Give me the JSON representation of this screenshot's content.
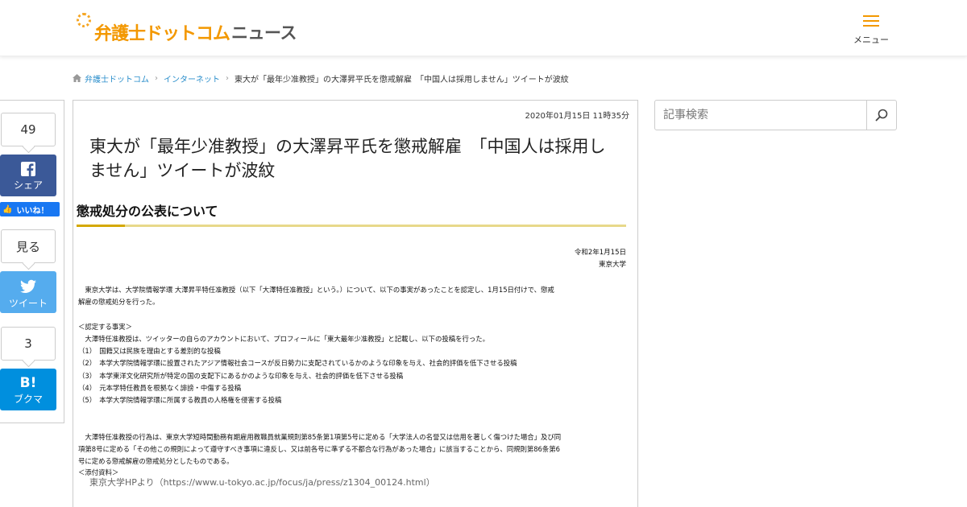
{
  "header": {
    "logo_text": "弁護士ドットコム",
    "logo_news": "ニュース",
    "menu_label": "メニュー",
    "accent_color": "#f39800"
  },
  "breadcrumb": {
    "items": [
      "弁護士ドットコム",
      "インターネット"
    ],
    "current": "東大が「最年少准教授」の大澤昇平氏を懲戒解雇　「中国人は採用しません」ツイートが波紋"
  },
  "share": {
    "facebook_count": "49",
    "facebook_label": "シェア",
    "like_label": "いいね！",
    "twitter_count": "見る",
    "twitter_label": "ツイート",
    "hatena_count": "3",
    "hatena_icon": "B!",
    "hatena_label": "ブクマ",
    "colors": {
      "facebook": "#3b5998",
      "twitter": "#55acee",
      "hatena": "#008fde"
    }
  },
  "article": {
    "date": "2020年01月15日 11時35分",
    "title": "東大が「最年少准教授」の大澤昇平氏を懲戒解雇　「中国人は採用しません」ツイートが波紋",
    "caption": "東京大学HPより（https://www.u-tokyo.ac.jp/focus/ja/press/z1304_00124.html）"
  },
  "document": {
    "heading": "懲戒処分の公表について",
    "date": "令和2年1月15日",
    "issuer": "東京大学",
    "lines": [
      "　東京大学は、大学院情報学環 大澤昇平特任准教授（以下「大澤特任准教授」という。）について、以下の事実があったことを認定し、1月15日付けで、懲戒",
      "解雇の懲戒処分を行った。",
      "",
      "＜認定する事実＞",
      "　大澤特任准教授は、ツイッターの自らのアカウントにおいて、プロフィールに「東大最年少准教授」と記載し、以下の投稿を行った。",
      "（1）　国籍又は民族を理由とする差別的な投稿",
      "（2）　本学大学院情報学環に設置されたアジア情報社会コースが反日勢力に支配されているかのような印象を与え、社会的評価を低下させる投稿",
      "（3）　本学東洋文化研究所が特定の国の支配下にあるかのような印象を与え、社会的評価を低下させる投稿",
      "（4）　元本学特任教員を根拠なく誹謗・中傷する投稿",
      "（5）　本学大学院情報学環に所属する教員の人格権を侵害する投稿",
      "",
      "",
      "　大澤特任准教授の行為は、東京大学短時間勤務有期雇用教職員就業規則第85条第1項第5号に定める「大学法人の名誉又は信用を著しく傷つけた場合」及び同",
      "項第8号に定める「その他この規則によって遵守すべき事項に違反し、又は前各号に準ずる不都合な行為があった場合」に該当することから、同規則第86条第6",
      "号に定める懲戒解雇の懲戒処分としたものである。"
    ],
    "bottom": "＜添付資料＞"
  },
  "search": {
    "placeholder": "記事検索"
  }
}
